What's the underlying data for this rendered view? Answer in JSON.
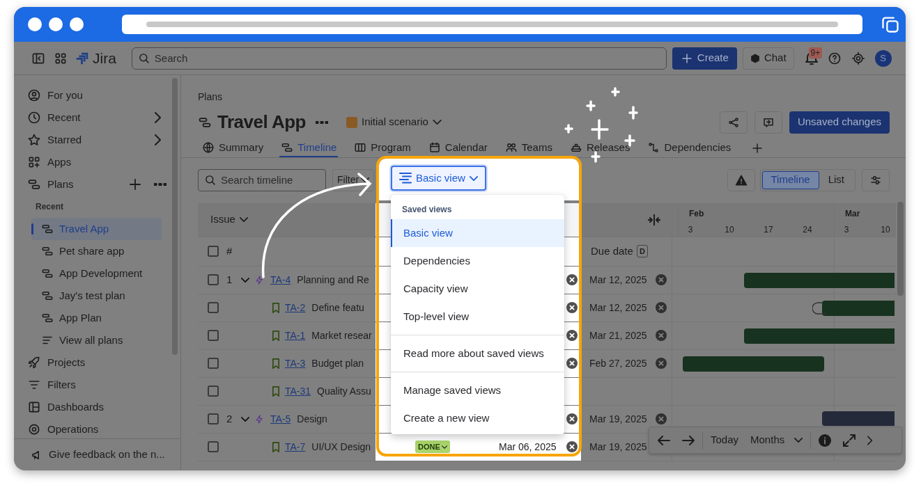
{
  "topbar": {
    "product": "Jira",
    "search_placeholder": "Search",
    "create_button": "Create",
    "chat_button": "Chat",
    "notification_count": "9+",
    "avatar_initial": "S"
  },
  "sidebar": {
    "items": [
      {
        "label": "For you",
        "has_submenu": false,
        "has_actions": false
      },
      {
        "label": "Recent",
        "has_submenu": true,
        "has_actions": false
      },
      {
        "label": "Starred",
        "has_submenu": true,
        "has_actions": false
      },
      {
        "label": "Apps",
        "has_submenu": false,
        "has_actions": false
      },
      {
        "label": "Plans",
        "has_submenu": false,
        "has_actions": true,
        "section_label": "Recent",
        "children": [
          {
            "label": "Travel App",
            "kind": "plan",
            "selected": true
          },
          {
            "label": "Pet share app",
            "kind": "plan",
            "selected": false
          },
          {
            "label": "App Development",
            "kind": "plan",
            "selected": false
          },
          {
            "label": "Jay's test plan",
            "kind": "plan",
            "selected": false
          },
          {
            "label": "App Plan",
            "kind": "plan",
            "selected": false
          },
          {
            "label": "View all plans",
            "kind": "link",
            "selected": false
          }
        ]
      },
      {
        "label": "Projects",
        "has_submenu": false,
        "has_actions": false
      },
      {
        "label": "Filters",
        "has_submenu": false,
        "has_actions": false
      },
      {
        "label": "Dashboards",
        "has_submenu": false,
        "has_actions": false
      },
      {
        "label": "Operations",
        "has_submenu": false,
        "has_actions": false
      }
    ],
    "feedback": "Give feedback on the n..."
  },
  "main": {
    "breadcrumb": "Plans",
    "title": "Travel App",
    "scenario": "Initial scenario",
    "action_button": "Unsaved changes",
    "tabs": [
      {
        "label": "Summary",
        "selected": false
      },
      {
        "label": "Timeline",
        "selected": true
      },
      {
        "label": "Program",
        "selected": false
      },
      {
        "label": "Calendar",
        "selected": false
      },
      {
        "label": "Teams",
        "selected": false
      },
      {
        "label": "Releases",
        "selected": false
      },
      {
        "label": "Dependencies",
        "selected": false
      }
    ],
    "search_placeholder": "Search timeline",
    "filter_button": "Filter",
    "view_button": "Basic view",
    "view_toggle": [
      {
        "label": "Timeline",
        "selected": true
      },
      {
        "label": "List",
        "selected": false
      }
    ]
  },
  "view_menu": {
    "heading": "Saved views",
    "views": [
      {
        "label": "Basic view",
        "selected": true
      },
      {
        "label": "Dependencies",
        "selected": false
      },
      {
        "label": "Capacity view",
        "selected": false
      },
      {
        "label": "Top-level view",
        "selected": false
      }
    ],
    "help_link": "Read more about saved views",
    "actions": [
      "Manage saved views",
      "Create a new view"
    ]
  },
  "table": {
    "issue_header": "Issue",
    "number_header": "#",
    "all_checked": false,
    "due_header": "Due date",
    "due_shortcut": "D",
    "months": [
      {
        "label": "Feb",
        "days": [
          "3",
          "10",
          "17",
          "24"
        ]
      },
      {
        "label": "Mar",
        "days": [
          "3",
          "10"
        ]
      }
    ],
    "rows": [
      {
        "kind": "epic",
        "checked": false,
        "number": "1",
        "expanded": true,
        "key": "TA-4",
        "summary": "Planning and Re",
        "start_clear": true,
        "due_date": "Mar 12, 2025",
        "due_clear": true,
        "color": "#17321f",
        "children": [
          {
            "kind": "story",
            "checked": false,
            "key": "TA-2",
            "summary": "Define featu",
            "start_clear": true,
            "due_date": "Mar 12, 2025",
            "due_clear": true,
            "color": "#17321f"
          },
          {
            "kind": "story",
            "checked": false,
            "key": "TA-1",
            "summary": "Market resear",
            "start_clear": true,
            "due_date": "Mar 21, 2025",
            "due_clear": true,
            "color": "#17321f"
          },
          {
            "kind": "story",
            "checked": false,
            "key": "TA-3",
            "summary": "Budget plan",
            "start_clear": true,
            "due_date": "Feb 27, 2025",
            "due_clear": true,
            "color": "#17321f"
          },
          {
            "kind": "story",
            "checked": false,
            "key": "TA-31",
            "summary": "Quality Assu",
            "start_clear": false,
            "due_clear": false
          }
        ]
      },
      {
        "kind": "epic",
        "checked": false,
        "number": "2",
        "expanded": true,
        "key": "TA-5",
        "summary": "Design",
        "start_clear": true,
        "due_date": "Mar 19, 2025",
        "due_clear": true,
        "color": "#252a3a",
        "children": [
          {
            "kind": "story",
            "checked": false,
            "key": "TA-7",
            "summary": "UI/UX Design",
            "status": "DONE",
            "start_date": "Mar 06, 2025",
            "start_clear": true,
            "due_date": "Mar 19, 2025",
            "due_clear": false
          }
        ]
      }
    ]
  },
  "timeline_controls": {
    "today": "Today",
    "scale": "Months"
  }
}
